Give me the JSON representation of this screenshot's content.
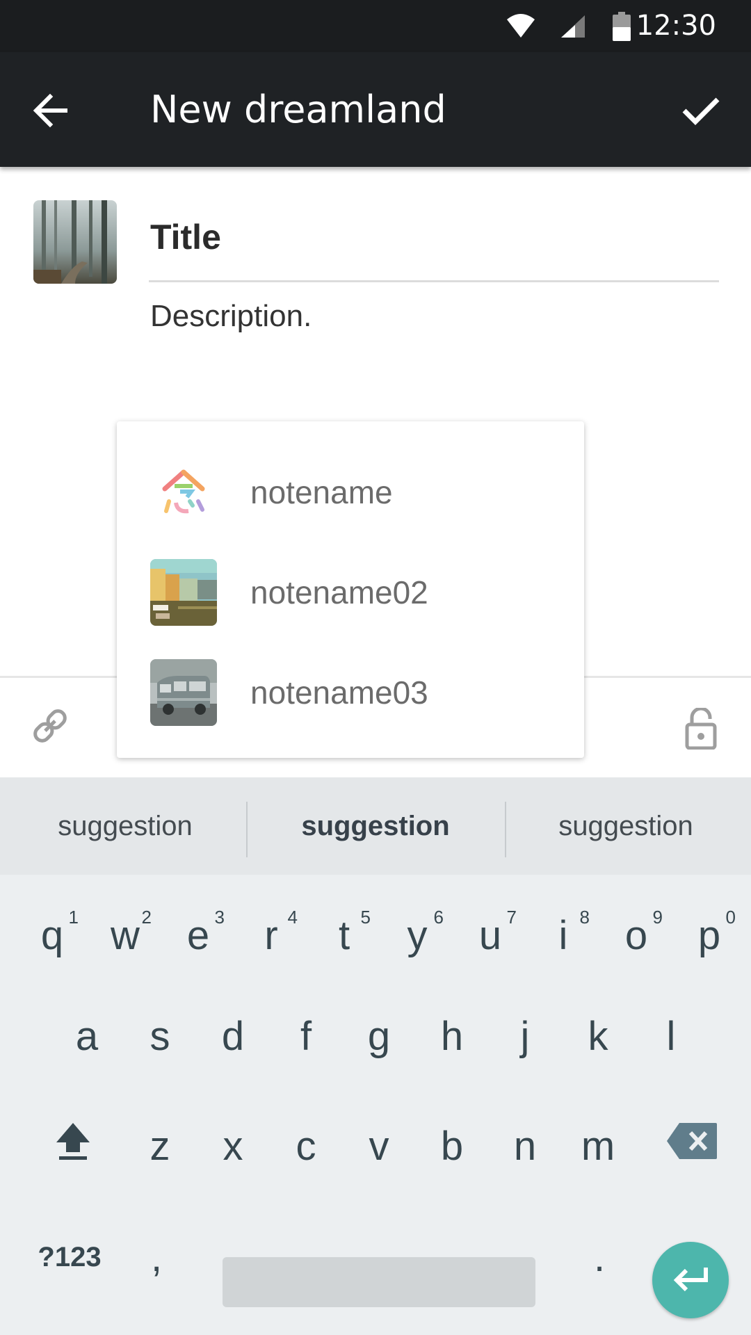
{
  "status_bar": {
    "time": "12:30",
    "icons": [
      "wifi-icon",
      "signal-icon",
      "battery-icon"
    ]
  },
  "app_bar": {
    "title": "New dreamland",
    "back_icon": "arrow-back-icon",
    "done_icon": "check-icon"
  },
  "form": {
    "title_placeholder": "Title",
    "description_placeholder": "Description."
  },
  "toolbar": {
    "link_icon": "link-icon",
    "lock_icon": "lock-icon"
  },
  "popup": {
    "items": [
      {
        "label": "notename",
        "icon": "notename-logo-icon"
      },
      {
        "label": "notename02",
        "icon": "canal-photo-thumbnail"
      },
      {
        "label": "notename03",
        "icon": "van-photo-thumbnail"
      }
    ]
  },
  "keyboard": {
    "suggestions": [
      "suggestion",
      "suggestion",
      "suggestion"
    ],
    "row1": [
      {
        "key": "q",
        "hint": "1"
      },
      {
        "key": "w",
        "hint": "2"
      },
      {
        "key": "e",
        "hint": "3"
      },
      {
        "key": "r",
        "hint": "4"
      },
      {
        "key": "t",
        "hint": "5"
      },
      {
        "key": "y",
        "hint": "6"
      },
      {
        "key": "u",
        "hint": "7"
      },
      {
        "key": "i",
        "hint": "8"
      },
      {
        "key": "o",
        "hint": "9"
      },
      {
        "key": "p",
        "hint": "0"
      }
    ],
    "row2": [
      "a",
      "s",
      "d",
      "f",
      "g",
      "h",
      "j",
      "k",
      "l"
    ],
    "row3": [
      "z",
      "x",
      "c",
      "v",
      "b",
      "n",
      "m"
    ],
    "symbols_label": "?123",
    "comma": ",",
    "period": ".",
    "accent_color": "#4db6ac"
  }
}
